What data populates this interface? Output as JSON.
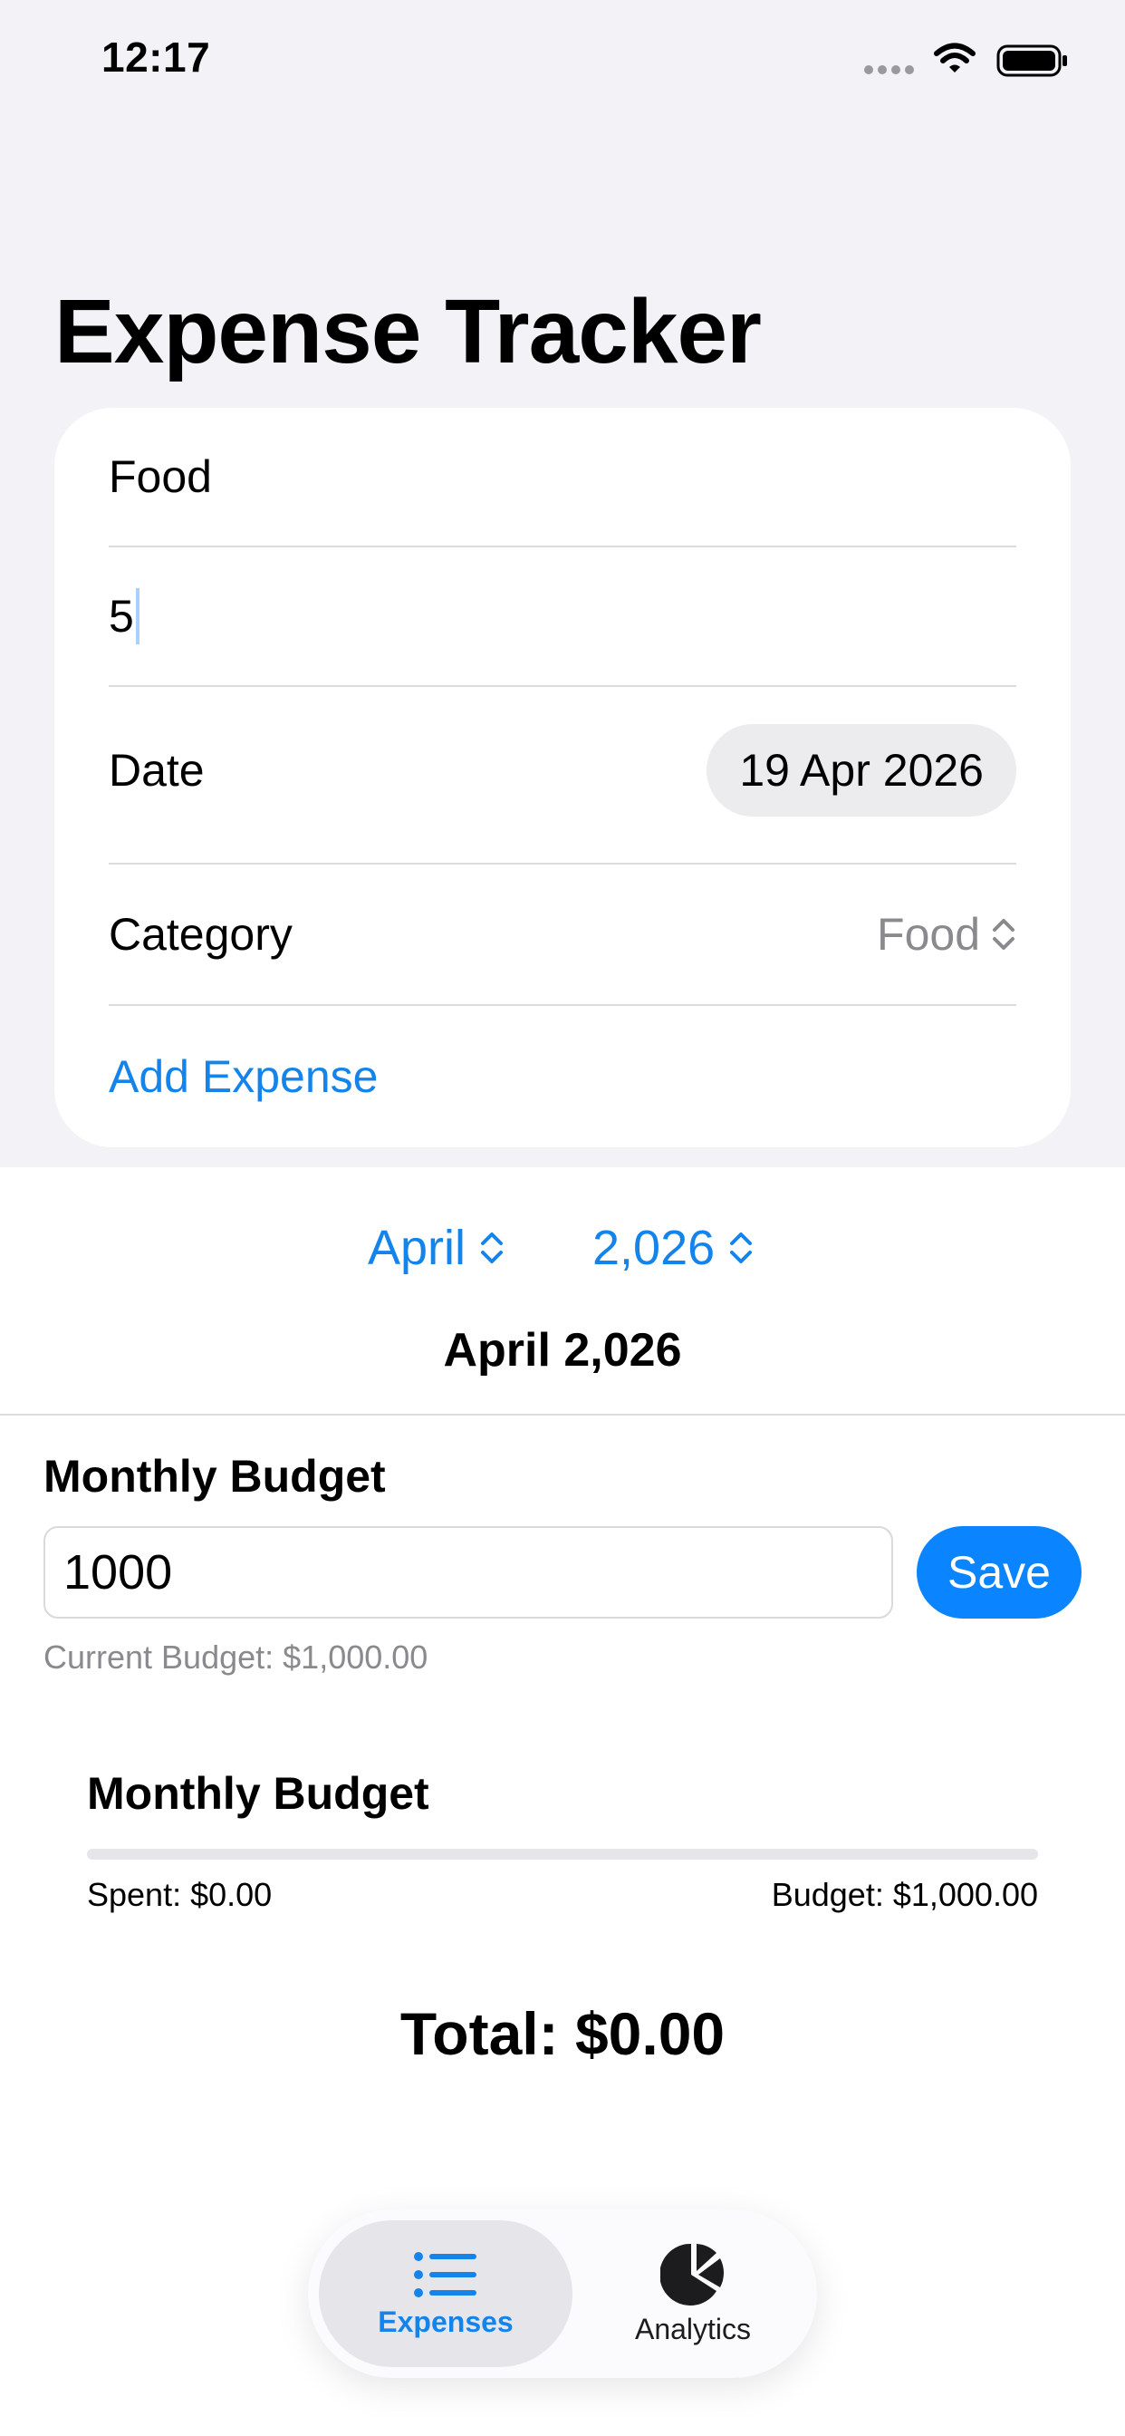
{
  "status_bar": {
    "time": "12:17"
  },
  "title": "Expense Tracker",
  "form": {
    "name_value": "Food",
    "amount_value": "5",
    "date_label": "Date",
    "date_value": "19 Apr 2026",
    "category_label": "Category",
    "category_value": "Food",
    "add_button": "Add Expense"
  },
  "period": {
    "month": "April",
    "year": "2,026",
    "label": "April 2,026"
  },
  "budget": {
    "heading": "Monthly Budget",
    "input_value": "1000",
    "save_label": "Save",
    "current": "Current Budget: $1,000.00"
  },
  "progress": {
    "heading": "Monthly Budget",
    "spent": "Spent: $0.00",
    "budget": "Budget: $1,000.00",
    "fraction": 0
  },
  "total": "Total: $0.00",
  "tabs": [
    {
      "label": "Expenses",
      "icon": "list-icon",
      "selected": true
    },
    {
      "label": "Analytics",
      "icon": "pie-chart-icon",
      "selected": false
    }
  ],
  "colors": {
    "accent": "#0a84ff",
    "link": "#1483ea",
    "background": "#f2f2f7"
  }
}
